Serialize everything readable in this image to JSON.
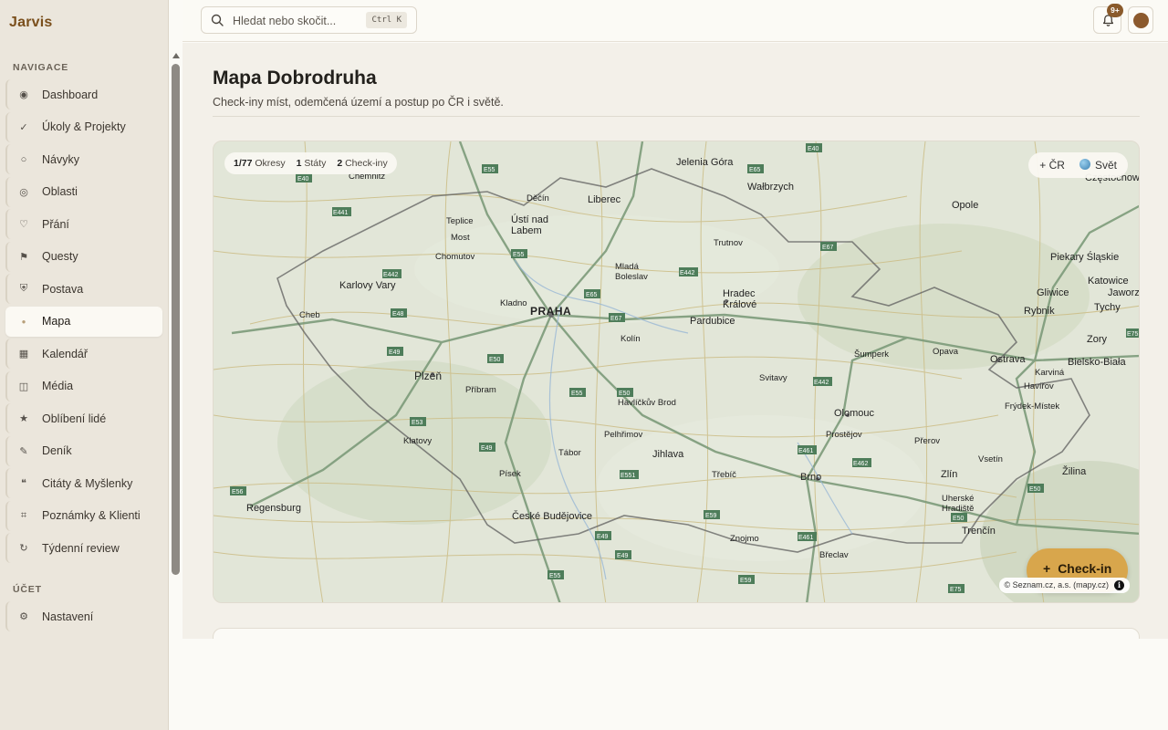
{
  "app": {
    "brand": "Jarvis"
  },
  "sidebar": {
    "nav_title": "NAVIGACE",
    "items": [
      {
        "label": "Dashboard",
        "icon": "◉"
      },
      {
        "label": "Úkoly & Projekty",
        "icon": "✓"
      },
      {
        "label": "Návyky",
        "icon": "○"
      },
      {
        "label": "Oblasti",
        "icon": "◎"
      },
      {
        "label": "Přání",
        "icon": "♡"
      },
      {
        "label": "Questy",
        "icon": "⚑"
      },
      {
        "label": "Postava",
        "icon": "⛨"
      },
      {
        "label": "Mapa",
        "icon": "●"
      },
      {
        "label": "Kalendář",
        "icon": "▦"
      },
      {
        "label": "Média",
        "icon": "◫"
      },
      {
        "label": "Oblíbení lidé",
        "icon": "★"
      },
      {
        "label": "Deník",
        "icon": "✎"
      },
      {
        "label": "Citáty & Myšlenky",
        "icon": "❝"
      },
      {
        "label": "Poznámky & Klienti",
        "icon": "⌗"
      },
      {
        "label": "Týdenní review",
        "icon": "↻"
      }
    ],
    "active_item": "Mapa",
    "account_title": "ÚČET",
    "account_items": [
      {
        "label": "Nastavení",
        "icon": "⚙"
      }
    ]
  },
  "topbar": {
    "search_placeholder": "Hledat nebo skočit...",
    "search_shortcut": "Ctrl K",
    "notifications_badge": "9+"
  },
  "page": {
    "title": "Mapa Dobrodruha",
    "subtitle": "Check-iny míst, odemčená území a postup po ČR i světě."
  },
  "map": {
    "stats": [
      {
        "value": "1/77",
        "label": "Okresy"
      },
      {
        "value": "1",
        "label": "Státy"
      },
      {
        "value": "2",
        "label": "Check-iny"
      }
    ],
    "switch": {
      "cr_label": "+ ČR",
      "world_label": "Svět"
    },
    "checkin_label": "Check-in",
    "attribution": "© Seznam.cz, a.s. (mapy.cz)",
    "place_labels": [
      {
        "name": "PRAHA",
        "major": true
      },
      {
        "name": "Plzeň"
      },
      {
        "name": "Liberec"
      },
      {
        "name": "Ústí nad Labem"
      },
      {
        "name": "Karlovy Vary"
      },
      {
        "name": "Cheb"
      },
      {
        "name": "Chomutov"
      },
      {
        "name": "Most"
      },
      {
        "name": "Teplice"
      },
      {
        "name": "Děčín"
      },
      {
        "name": "Mladá Boleslav"
      },
      {
        "name": "Kladno"
      },
      {
        "name": "Hradec Králové"
      },
      {
        "name": "Pardubice"
      },
      {
        "name": "Kolín"
      },
      {
        "name": "Trutnov"
      },
      {
        "name": "Jelenia Góra"
      },
      {
        "name": "Wałbrzych"
      },
      {
        "name": "Opole"
      },
      {
        "name": "Częstochowa"
      },
      {
        "name": "Piekary Śląskie"
      },
      {
        "name": "Katowice"
      },
      {
        "name": "Gliwice"
      },
      {
        "name": "Jaworz"
      },
      {
        "name": "Rybnik"
      },
      {
        "name": "Tychy"
      },
      {
        "name": "Zory"
      },
      {
        "name": "Ostrava"
      },
      {
        "name": "Bielsko-Biała"
      },
      {
        "name": "Karviná"
      },
      {
        "name": "Havířov"
      },
      {
        "name": "Frýdek-Místek"
      },
      {
        "name": "Šumperk"
      },
      {
        "name": "Opava"
      },
      {
        "name": "Olomouc"
      },
      {
        "name": "Prostějov"
      },
      {
        "name": "Přerov"
      },
      {
        "name": "Zlín"
      },
      {
        "name": "Vsetín"
      },
      {
        "name": "Žilina"
      },
      {
        "name": "Brno"
      },
      {
        "name": "Třebíč"
      },
      {
        "name": "Jihlava"
      },
      {
        "name": "Havlíčkův Brod"
      },
      {
        "name": "Pelhřimov"
      },
      {
        "name": "Tábor"
      },
      {
        "name": "Písek"
      },
      {
        "name": "Příbram"
      },
      {
        "name": "Klatovy"
      },
      {
        "name": "České Budějovice"
      },
      {
        "name": "Znojmo"
      },
      {
        "name": "Břeclav"
      },
      {
        "name": "Uherské Hradiště"
      },
      {
        "name": "Trenčín"
      },
      {
        "name": "Regensburg"
      },
      {
        "name": "Svitavy"
      },
      {
        "name": "Chemnitz"
      }
    ],
    "road_labels": [
      "E55",
      "E40",
      "E65",
      "E67",
      "E441",
      "E442",
      "E48",
      "E49",
      "E50",
      "E53",
      "E59",
      "E461",
      "E462",
      "E75",
      "E551",
      "E56"
    ]
  }
}
